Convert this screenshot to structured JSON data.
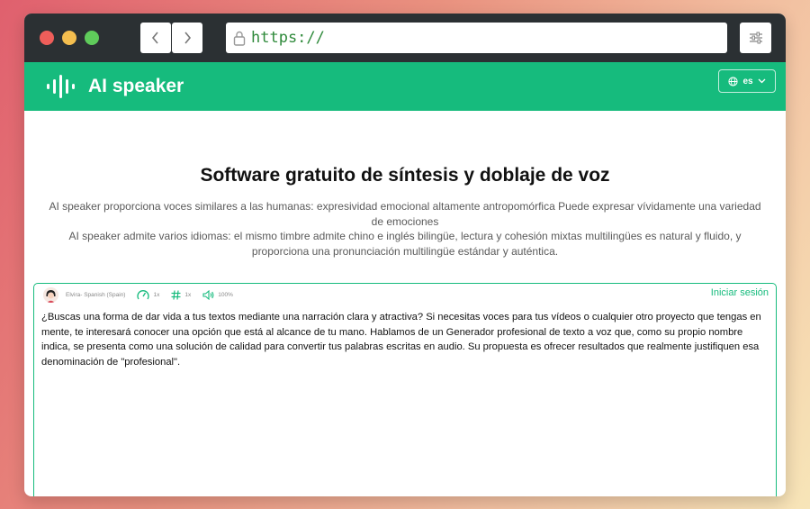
{
  "browser": {
    "url": "https://",
    "back_icon": "chevron-left-icon",
    "forward_icon": "chevron-right-icon",
    "lock_icon": "lock-icon",
    "settings_icon": "sliders-icon"
  },
  "app": {
    "brand": "AI speaker",
    "logo_icon": "sound-wave-icon",
    "language": "es",
    "accent_color": "#16bb7d"
  },
  "main": {
    "title": "Software gratuito de síntesis y doblaje de voz",
    "description_1": "AI speaker proporciona voces similares a las humanas: expresividad emocional altamente antropomórfica Puede expresar vívidamente una variedad de emociones",
    "description_2": "AI speaker admite varios idiomas: el mismo timbre admite chino e inglés bilingüe, lectura y cohesión mixtas multilingües es natural y fluido, y proporciona una pronunciación multilingüe estándar y auténtica."
  },
  "editor": {
    "voice_name": "Elvira- Spanish (Spain)",
    "speed": "1x",
    "pitch": "1x",
    "volume": "100%",
    "login_label": "Iniciar sesión",
    "text": "¿Buscas una forma de dar vida a tus textos mediante una narración clara y atractiva? Si necesitas voces para tus vídeos o cualquier otro proyecto que tengas en mente, te interesará conocer una opción que está al alcance de tu mano. Hablamos de un Generador profesional de texto a voz que, como su propio nombre indica, se presenta como una solución de calidad para convertir tus palabras escritas en audio. Su propuesta es ofrecer resultados que realmente justifiquen esa denominación de \"profesional\"."
  }
}
